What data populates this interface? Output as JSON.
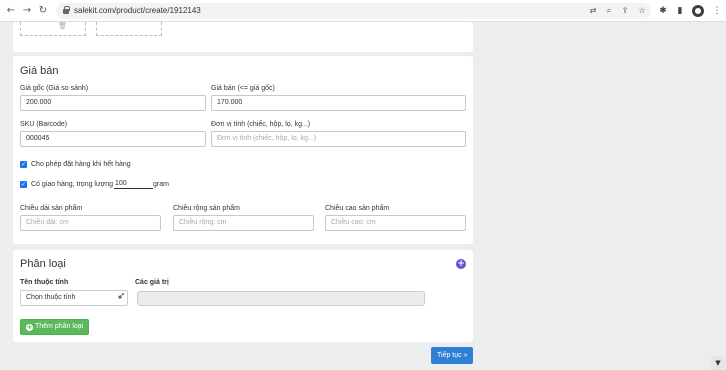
{
  "browser": {
    "url": "salekit.com/product/create/1912143"
  },
  "pricing": {
    "title": "Giá bán",
    "original_price_label": "Giá gốc (Giá so sánh)",
    "original_price_value": "200.000",
    "sale_price_label": "Giá bán (<= giá gốc)",
    "sale_price_value": "170.000",
    "sku_label": "SKU (Barcode)",
    "sku_value": "000045",
    "unit_label": "Đơn vị tính (chiếc, hộp, lọ, kg...)",
    "unit_placeholder": "Đơn vị tính (chiếc, hộp, lọ, kg...)",
    "allow_backorder_label": "Cho phép đặt hàng khi hết hàng",
    "allow_backorder_checked": true,
    "shipping_label": "Có giao hàng, trọng lượng",
    "shipping_checked": true,
    "weight_value": "100",
    "weight_unit": "gram",
    "length_label": "Chiều dài sản phẩm",
    "length_placeholder": "Chiều dài: cm",
    "width_label": "Chiều rộng sản phẩm",
    "width_placeholder": "Chiều rộng: cm",
    "height_label": "Chiều cao sản phẩm",
    "height_placeholder": "Chiều cao: cm"
  },
  "variants": {
    "title": "Phân loại",
    "attr_name_header": "Tên thuộc tính",
    "attr_values_header": "Các giá trị",
    "attr_select_value": "Chọn thuộc tính",
    "add_button_label": "Thêm phân loại"
  },
  "footer": {
    "next_button_label": "Tiếp tục »"
  }
}
